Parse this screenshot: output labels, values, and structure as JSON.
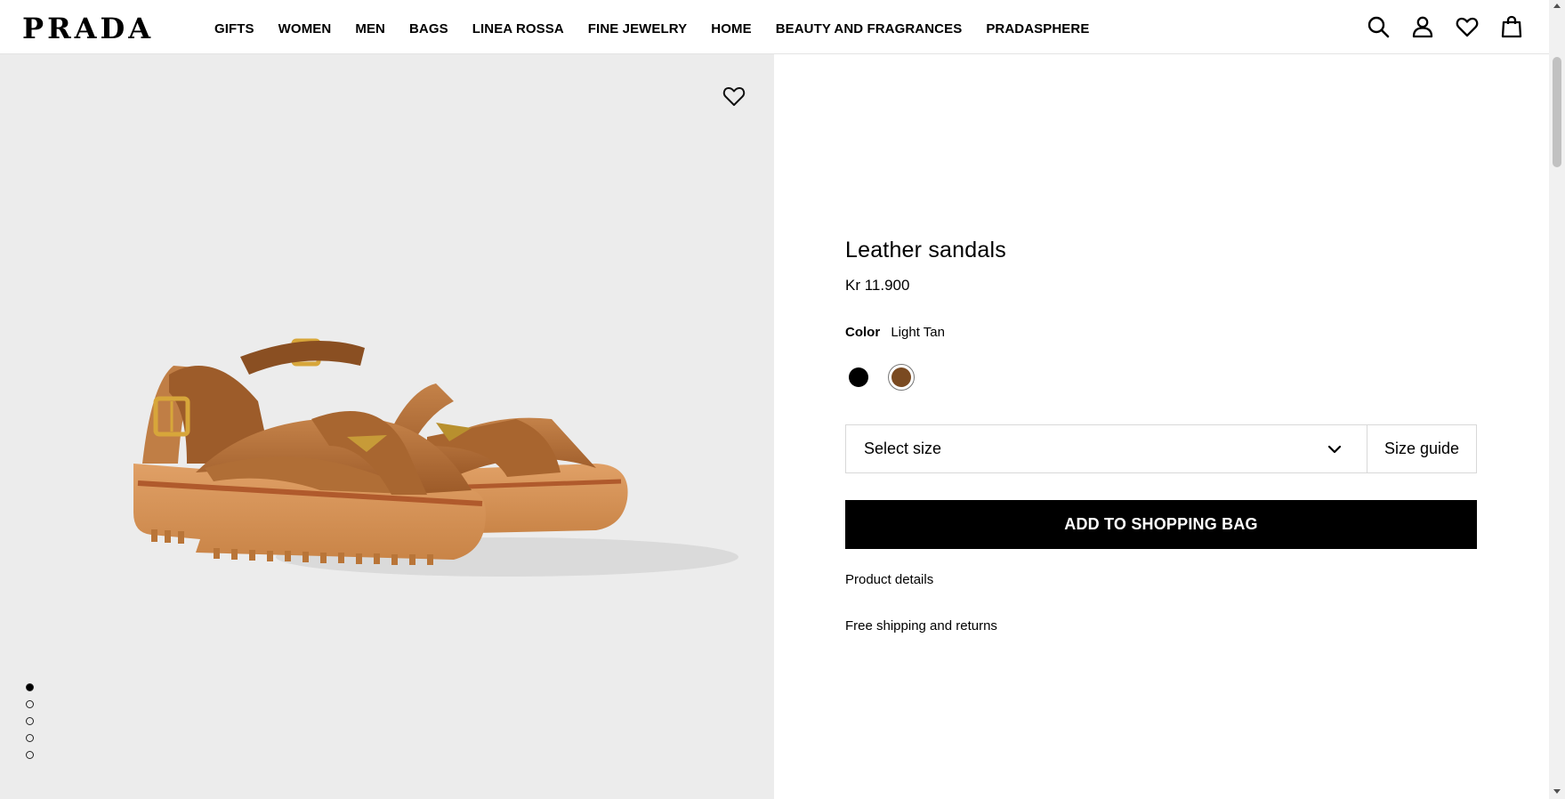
{
  "header": {
    "logo": "PRADA",
    "nav": [
      "GIFTS",
      "WOMEN",
      "MEN",
      "BAGS",
      "LINEA ROSSA",
      "FINE JEWELRY",
      "HOME",
      "BEAUTY AND FRAGRANCES",
      "PRADASPHERE"
    ],
    "icons": [
      "search-icon",
      "account-icon",
      "wishlist-icon",
      "shopping-bag-icon"
    ]
  },
  "gallery": {
    "image_count": 5,
    "active_index": 0
  },
  "product": {
    "title": "Leather sandals",
    "price": "Kr 11.900",
    "color_label": "Color",
    "color_value": "Light Tan",
    "swatches": [
      {
        "name": "Black",
        "hex": "#000000",
        "selected": false
      },
      {
        "name": "Light Tan",
        "hex": "#7a4a21",
        "selected": true
      }
    ],
    "size_placeholder": "Select size",
    "size_guide": "Size guide",
    "add_to_bag": "ADD TO SHOPPING BAG",
    "product_details": "Product details",
    "shipping": "Free shipping and returns"
  },
  "colors": {
    "gallery_bg": "#ececec",
    "leather": "#b5703a",
    "sole": "#d99555"
  }
}
